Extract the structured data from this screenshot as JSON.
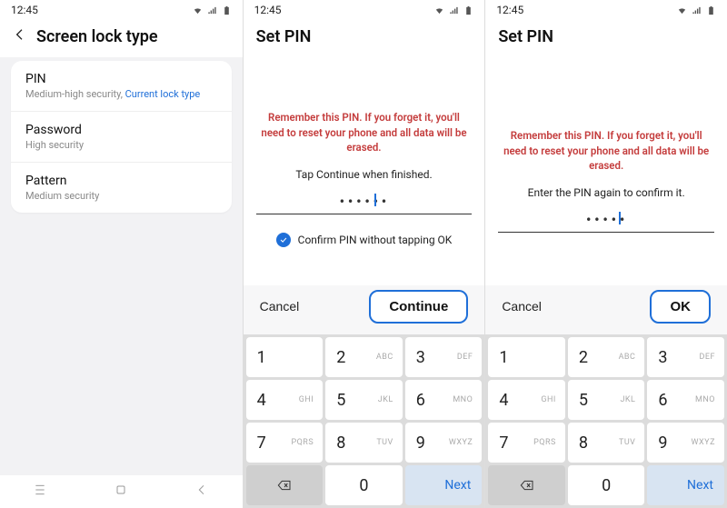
{
  "status": {
    "time": "12:45"
  },
  "screen1": {
    "title": "Screen lock type",
    "items": [
      {
        "title": "PIN",
        "sub_prefix": "Medium-high security, ",
        "sub_accent": "Current lock type"
      },
      {
        "title": "Password",
        "sub": "High security"
      },
      {
        "title": "Pattern",
        "sub": "Medium security"
      }
    ]
  },
  "screen2": {
    "title": "Set PIN",
    "warning": "Remember this PIN. If you forget it, you'll need to reset your phone and all data will be erased.",
    "instruct": "Tap Continue when finished.",
    "pin_mask": "••••••",
    "confirm_label": "Confirm PIN without tapping OK",
    "cancel": "Cancel",
    "primary": "Continue"
  },
  "screen3": {
    "title": "Set PIN",
    "warning": "Remember this PIN. If you forget it, you'll need to reset your phone and all data will be erased.",
    "instruct": "Enter the PIN again to confirm it.",
    "pin_mask": "•••••",
    "cancel": "Cancel",
    "primary": "OK"
  },
  "keypad": {
    "keys": [
      {
        "d": "1",
        "l": ""
      },
      {
        "d": "2",
        "l": "ABC"
      },
      {
        "d": "3",
        "l": "DEF"
      },
      {
        "d": "4",
        "l": "GHI"
      },
      {
        "d": "5",
        "l": "JKL"
      },
      {
        "d": "6",
        "l": "MNO"
      },
      {
        "d": "7",
        "l": "PQRS"
      },
      {
        "d": "8",
        "l": "TUV"
      },
      {
        "d": "9",
        "l": "WXYZ"
      }
    ],
    "zero": "0",
    "next": "Next"
  }
}
